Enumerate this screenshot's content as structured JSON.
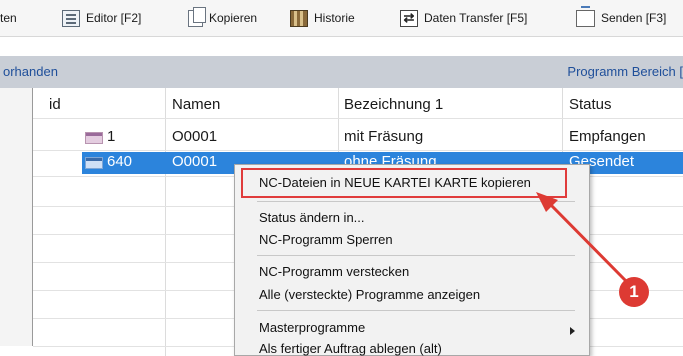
{
  "toolbar": {
    "items": [
      {
        "label": "ten"
      },
      {
        "label": "Editor [F2]"
      },
      {
        "label": "Kopieren"
      },
      {
        "label": "Historie"
      },
      {
        "label": "Daten Transfer [F5]"
      },
      {
        "label": "Senden [F3]"
      }
    ]
  },
  "band": {
    "left": "orhanden",
    "right": "Programm Bereich ["
  },
  "table": {
    "headers": [
      "id",
      "Namen",
      "Bezeichnung 1",
      "Status"
    ],
    "rows": [
      {
        "id": "1",
        "name": "O0001",
        "desc": "mit Fräsung",
        "status": "Empfangen"
      },
      {
        "id": "640",
        "name": "O0001",
        "desc": "ohne Fräsung",
        "status": "Gesendet"
      }
    ]
  },
  "context_menu": {
    "items": [
      "NC-Dateien in NEUE KARTEI KARTE kopieren",
      "Status ändern in...",
      "NC-Programm Sperren",
      "NC-Programm verstecken",
      "Alle (versteckte) Programme anzeigen",
      "Masterprogramme",
      "Als fertiger Auftrag ablegen (alt)"
    ]
  },
  "annotation": {
    "badge": "1",
    "color": "#dd3a33"
  }
}
